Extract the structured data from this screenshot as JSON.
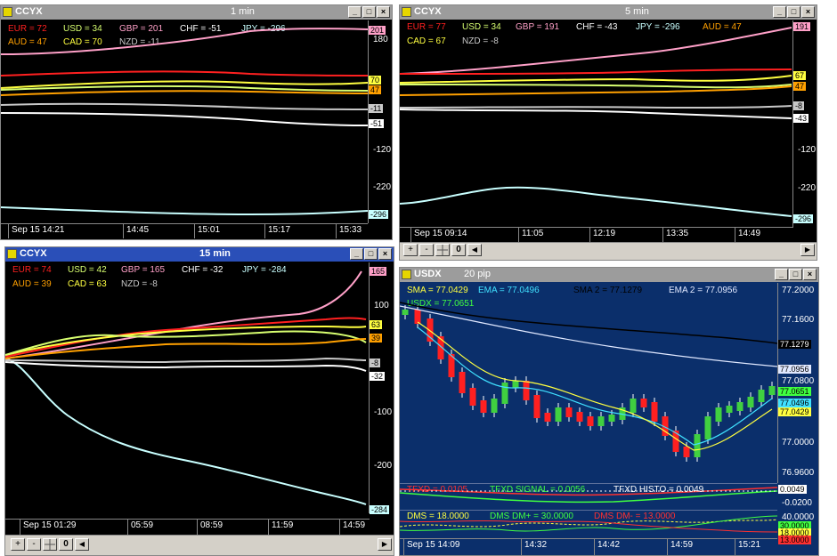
{
  "controls": {
    "minimize": "_",
    "maximize": "□",
    "close": "×",
    "zoom_in": "+",
    "zoom_out": "-",
    "zero": "0",
    "scroll_left": "◀",
    "scroll_right": "▶"
  },
  "win1": {
    "title": "CCYX",
    "period": "1 min",
    "legend": [
      {
        "text": "EUR = 72",
        "color": "#ff2020"
      },
      {
        "text": "USD = 34",
        "color": "#d8ff70"
      },
      {
        "text": "GBP = 201",
        "color": "#ffa0c8"
      },
      {
        "text": "CHF = -51",
        "color": "#ffffff"
      },
      {
        "text": "JPY = -296",
        "color": "#c8ffff"
      },
      {
        "text": "AUD = 47",
        "color": "#ffa000"
      },
      {
        "text": "CAD = 70",
        "color": "#ffff40"
      },
      {
        "text": "NZD = -11",
        "color": "#c8c8c8"
      }
    ],
    "y_ticks": [
      "180",
      "-120",
      "-220"
    ],
    "tags": [
      {
        "text": "201",
        "bg": "#ffa0c8"
      },
      {
        "text": "70",
        "bg": "#ffff40"
      },
      {
        "text": "47",
        "bg": "#ffa000"
      },
      {
        "text": "-11",
        "bg": "#c8c8c8"
      },
      {
        "text": "-51",
        "bg": "#ffffff"
      },
      {
        "text": "-296",
        "bg": "#c8ffff"
      }
    ],
    "x_ticks": [
      "Sep 15 14:21",
      "14:45",
      "15:01",
      "15:17",
      "15:33"
    ]
  },
  "win2": {
    "title": "CCYX",
    "period": "5 min",
    "legend": [
      {
        "text": "EUR = 77",
        "color": "#ff2020"
      },
      {
        "text": "USD = 34",
        "color": "#d8ff70"
      },
      {
        "text": "GBP = 191",
        "color": "#ffa0c8"
      },
      {
        "text": "CHF = -43",
        "color": "#ffffff"
      },
      {
        "text": "JPY = -296",
        "color": "#c8ffff"
      },
      {
        "text": "AUD = 47",
        "color": "#ffa000"
      },
      {
        "text": "CAD = 67",
        "color": "#ffff40"
      },
      {
        "text": "NZD = -8",
        "color": "#c8c8c8"
      }
    ],
    "y_ticks": [
      "-120",
      "-220"
    ],
    "tags": [
      {
        "text": "191",
        "bg": "#ffa0c8"
      },
      {
        "text": "67",
        "bg": "#ffff40"
      },
      {
        "text": "47",
        "bg": "#ffa000"
      },
      {
        "text": "-8",
        "bg": "#c8c8c8"
      },
      {
        "text": "-43",
        "bg": "#ffffff"
      },
      {
        "text": "-296",
        "bg": "#c8ffff"
      }
    ],
    "x_ticks": [
      "Sep 15 09:14",
      "11:05",
      "12:19",
      "13:35",
      "14:49"
    ]
  },
  "win3": {
    "title": "CCYX",
    "period": "15 min",
    "legend": [
      {
        "text": "EUR = 74",
        "color": "#ff2020"
      },
      {
        "text": "USD = 42",
        "color": "#d8ff70"
      },
      {
        "text": "GBP = 165",
        "color": "#ffa0c8"
      },
      {
        "text": "CHF = -32",
        "color": "#ffffff"
      },
      {
        "text": "JPY = -284",
        "color": "#c8ffff"
      },
      {
        "text": "AUD = 39",
        "color": "#ffa000"
      },
      {
        "text": "CAD = 63",
        "color": "#ffff40"
      },
      {
        "text": "NZD = -8",
        "color": "#c8c8c8"
      }
    ],
    "y_ticks": [
      "100",
      "-100",
      "-200"
    ],
    "tags": [
      {
        "text": "165",
        "bg": "#ffa0c8"
      },
      {
        "text": "63",
        "bg": "#ffff40"
      },
      {
        "text": "39",
        "bg": "#ffa000"
      },
      {
        "text": "-8",
        "bg": "#c8c8c8"
      },
      {
        "text": "-32",
        "bg": "#ffffff"
      },
      {
        "text": "-284",
        "bg": "#c8ffff"
      }
    ],
    "x_ticks": [
      "Sep 15 01:29",
      "05:59",
      "08:59",
      "11:59",
      "14:59"
    ]
  },
  "win4": {
    "title": "USDX",
    "period": "20 pip",
    "legend": [
      {
        "text": "SMA = 77.0429",
        "color": "#ffff40"
      },
      {
        "text": "EMA = 77.0496",
        "color": "#40e0ff"
      },
      {
        "text": "SMA 2 = 77.1279",
        "color": "#000000"
      },
      {
        "text": "EMA 2 = 77.0956",
        "color": "#e0e8ff"
      },
      {
        "text": "USDX = 77.0651",
        "color": "#40ff40"
      }
    ],
    "y_ticks": [
      "77.2000",
      "77.1600",
      "77.0800",
      "77.0000",
      "76.9600"
    ],
    "tags": [
      {
        "text": "77.1279",
        "bg": "#000000"
      },
      {
        "text": "77.0956",
        "bg": "#e0e8ff"
      },
      {
        "text": "77.0651",
        "bg": "#40ff40"
      },
      {
        "text": "77.0496",
        "bg": "#40e0ff"
      },
      {
        "text": "77.0429",
        "bg": "#ffff40"
      }
    ],
    "ind1_legend": [
      {
        "text": "TFXD = 0.0105",
        "color": "#ff3030"
      },
      {
        "text": "TFXD SIGNAL = 0.0056",
        "color": "#40ff40"
      },
      {
        "text": "TFXD HISTO = 0.0049",
        "color": "#ffffff"
      }
    ],
    "ind1_ticks": [
      "0.0049",
      "-0.0200"
    ],
    "ind2_legend": [
      {
        "text": "DMS = 18.0000",
        "color": "#ffff40"
      },
      {
        "text": "DMS DM+ = 30.0000",
        "color": "#40ff40"
      },
      {
        "text": "DMS DM- = 13.0000",
        "color": "#ff3030"
      }
    ],
    "ind2_ticks": [
      "40.0000",
      "30.0000",
      "18.0000",
      "13.0000"
    ],
    "x_ticks": [
      "Sep 15 14:09",
      "14:32",
      "14:42",
      "14:59",
      "15:21"
    ]
  }
}
